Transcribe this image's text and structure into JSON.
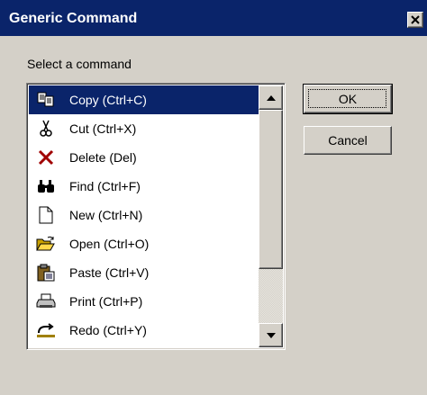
{
  "dialog": {
    "title": "Generic Command",
    "prompt": "Select a command"
  },
  "commands": [
    {
      "label": "Copy (Ctrl+C)",
      "icon": "copy-icon",
      "selected": true
    },
    {
      "label": "Cut (Ctrl+X)",
      "icon": "cut-icon",
      "selected": false
    },
    {
      "label": "Delete (Del)",
      "icon": "delete-icon",
      "selected": false
    },
    {
      "label": "Find (Ctrl+F)",
      "icon": "find-icon",
      "selected": false
    },
    {
      "label": "New (Ctrl+N)",
      "icon": "new-icon",
      "selected": false
    },
    {
      "label": "Open (Ctrl+O)",
      "icon": "open-icon",
      "selected": false
    },
    {
      "label": "Paste (Ctrl+V)",
      "icon": "paste-icon",
      "selected": false
    },
    {
      "label": "Print (Ctrl+P)",
      "icon": "print-icon",
      "selected": false
    },
    {
      "label": "Redo (Ctrl+Y)",
      "icon": "redo-icon",
      "selected": false
    }
  ],
  "buttons": {
    "ok_label": "OK",
    "cancel_label": "Cancel"
  },
  "colors": {
    "titlebar": "#0a246a",
    "face": "#d4d0c8",
    "selection": "#0a246a"
  }
}
